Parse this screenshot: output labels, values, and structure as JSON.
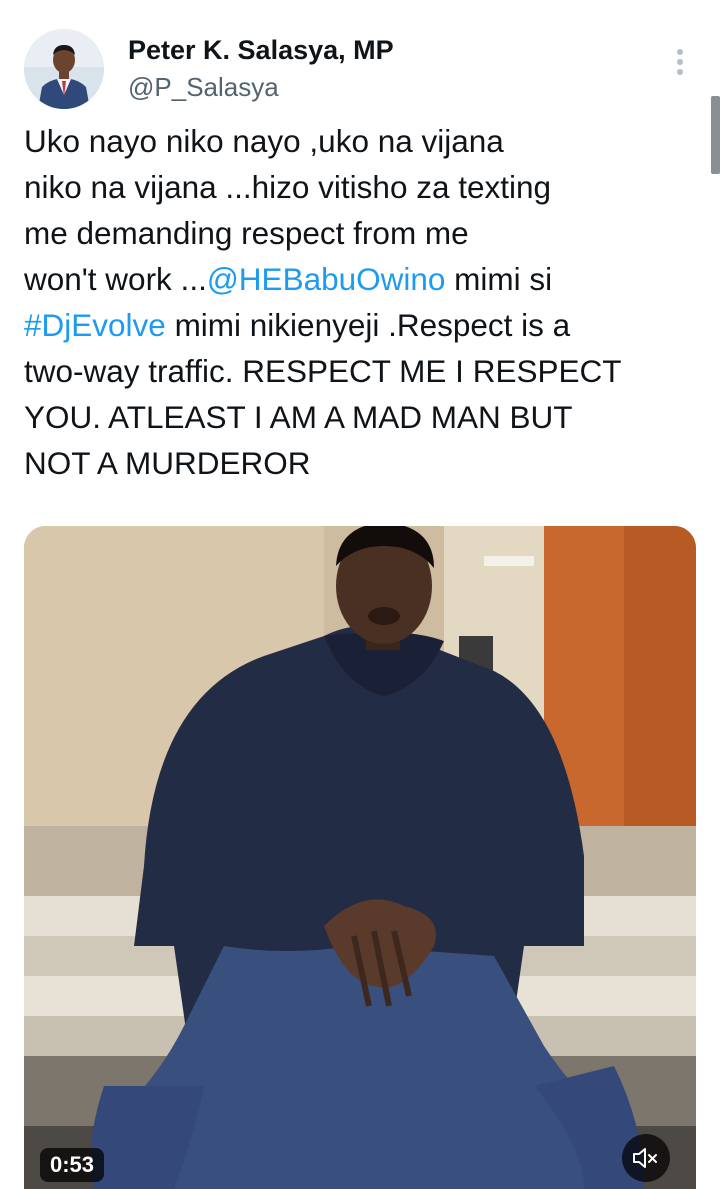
{
  "author": {
    "display_name": "Peter K. Salasya, MP",
    "handle": "@P_Salasya"
  },
  "icons": {
    "more": "more-vertical-icon",
    "mute": "speaker-muted-icon"
  },
  "tweet": {
    "lines": [
      {
        "segments": [
          {
            "text": "Uko nayo niko nayo ,uko na vijana",
            "link": false
          }
        ]
      },
      {
        "segments": [
          {
            "text": "niko na vijana ...hizo vitisho za texting",
            "link": false
          }
        ]
      },
      {
        "segments": [
          {
            "text": "me demanding respect from me",
            "link": false
          }
        ]
      },
      {
        "segments": [
          {
            "text": "won't work ...",
            "link": false
          },
          {
            "text": "@HEBabuOwino",
            "link": true,
            "kind": "mention"
          },
          {
            "text": " mimi si",
            "link": false
          }
        ]
      },
      {
        "segments": [
          {
            "text": "#DjEvolve",
            "link": true,
            "kind": "hashtag"
          },
          {
            "text": " mimi nikienyeji .Respect is a",
            "link": false
          }
        ]
      },
      {
        "segments": [
          {
            "text": "two-way traffic. RESPECT ME I RESPECT",
            "link": false
          }
        ]
      },
      {
        "segments": [
          {
            "text": "YOU. ATLEAST I AM A MAD MAN  BUT",
            "link": false
          }
        ]
      },
      {
        "segments": [
          {
            "text": "NOT A MURDEROR",
            "link": false
          }
        ]
      }
    ]
  },
  "video": {
    "duration": "0:53",
    "muted": true
  },
  "colors": {
    "link": "#1d9bf0",
    "secondary_text": "#536471",
    "primary_text": "#0f1419"
  }
}
